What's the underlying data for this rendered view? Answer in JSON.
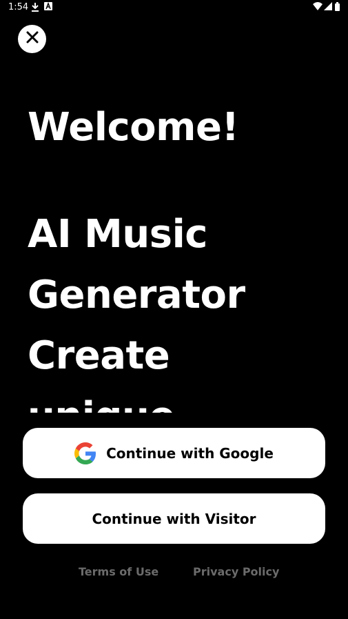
{
  "status_bar": {
    "time": "1:54",
    "icons": [
      "download-icon",
      "a-icon",
      "wifi-icon",
      "signal-icon",
      "battery-icon"
    ]
  },
  "close_icon": "close-icon",
  "headline": {
    "welcome": "Welcome!",
    "lines": [
      "AI Music",
      "Generator",
      "Create",
      "unique"
    ]
  },
  "buttons": {
    "google": "Continue with Google",
    "visitor": "Continue with Visitor"
  },
  "footer": {
    "terms": "Terms of Use",
    "privacy": "Privacy Policy"
  },
  "colors": {
    "background": "#000000",
    "button_bg": "#ffffff",
    "footer_text": "#6b6b6b",
    "google_blue": "#4285F4",
    "google_red": "#EA4335",
    "google_yellow": "#FBBC05",
    "google_green": "#34A853"
  }
}
